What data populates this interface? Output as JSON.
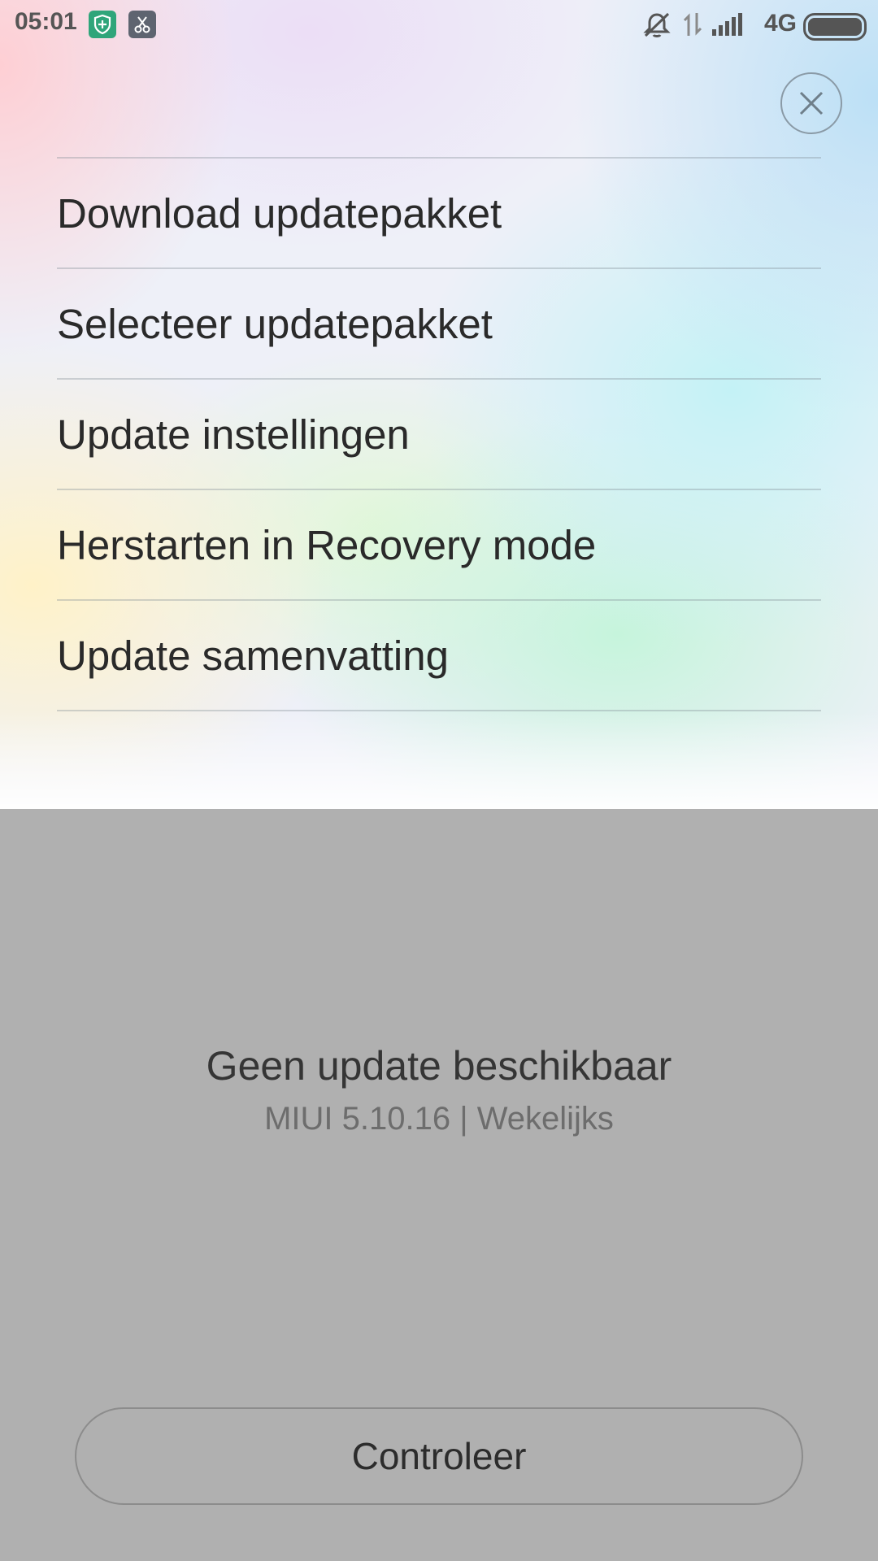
{
  "status_bar": {
    "time": "05:01",
    "network": "4G",
    "icons": [
      "shield-icon",
      "scissors-icon",
      "mute-icon",
      "data-arrows-icon",
      "signal-icon",
      "battery-icon"
    ]
  },
  "menu": {
    "close_icon": "close-icon",
    "items": [
      {
        "label": "Download updatepakket"
      },
      {
        "label": "Selecteer updatepakket"
      },
      {
        "label": "Update instellingen"
      },
      {
        "label": "Herstarten in Recovery mode"
      },
      {
        "label": "Update samenvatting"
      }
    ]
  },
  "update_status": {
    "title": "Geen update beschikbaar",
    "version": "MIUI 5.10.16 | Wekelijks"
  },
  "check_button": {
    "label": "Controleer"
  },
  "colors": {
    "background_dim": "#b0b0b0",
    "text_primary": "#2a2a2a",
    "text_secondary": "#6d6d6d",
    "shield_badge": "#2fa57a",
    "scissors_badge": "#5e6470"
  }
}
